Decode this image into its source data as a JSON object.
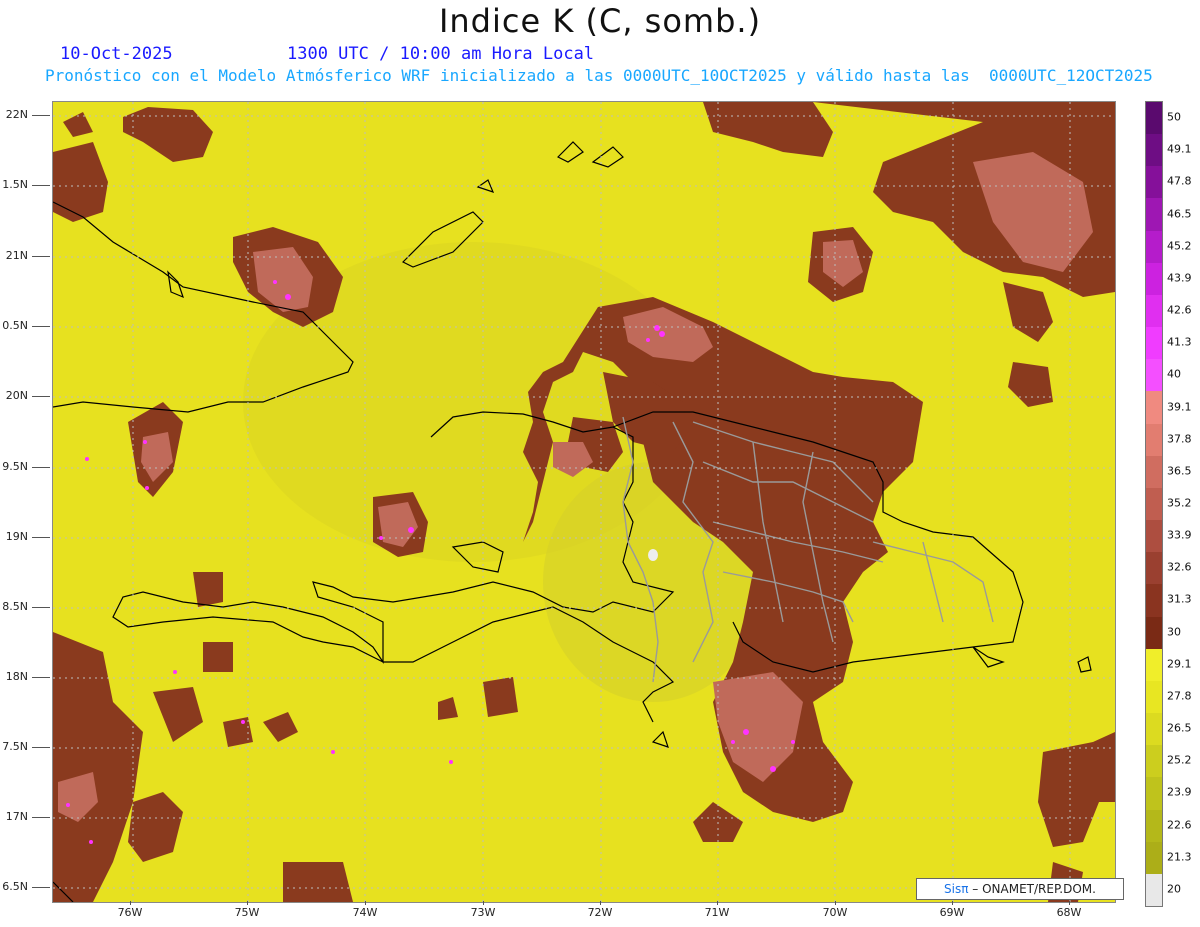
{
  "title": "Indice K (C, somb.)",
  "date": "10-Oct-2025",
  "time": "1300 UTC / 10:00 am Hora Local",
  "forecast_text": "Pronóstico con el Modelo Atmósferico WRF inicializado a las 0000UTC_10OCT2025 y válido hasta las  0000UTC_12OCT2025",
  "credit": {
    "brand": "Sisπ",
    "text": "– ONAMET/REP.DOM."
  },
  "lat_labels": [
    "22N",
    "1.5N",
    "21N",
    "0.5N",
    "20N",
    "9.5N",
    "19N",
    "8.5N",
    "18N",
    "7.5N",
    "17N",
    "6.5N"
  ],
  "lon_labels": [
    "76W",
    "75W",
    "74W",
    "73W",
    "72W",
    "71W",
    "70W",
    "69W",
    "68W"
  ],
  "colorbar": {
    "labels": [
      "50",
      "49.1",
      "47.8",
      "46.5",
      "45.2",
      "43.9",
      "42.6",
      "41.3",
      "40",
      "39.1",
      "37.8",
      "36.5",
      "35.2",
      "33.9",
      "32.6",
      "31.3",
      "30",
      "29.1",
      "27.8",
      "26.5",
      "25.2",
      "23.9",
      "22.6",
      "21.3",
      "20"
    ],
    "colors": [
      "#5a0a6e",
      "#6e0d84",
      "#85109a",
      "#9e17b3",
      "#b51ccb",
      "#cc22e0",
      "#e02ff0",
      "#f03cff",
      "#f44fff",
      "#f08a80",
      "#e27d70",
      "#d06d60",
      "#c05e50",
      "#ad4e40",
      "#9a4030",
      "#8a3420",
      "#7a2a15",
      "#f0ee2a",
      "#e8e622",
      "#dcdb20",
      "#ccce1e",
      "#bfc31c",
      "#b4b81a",
      "#acae18",
      "#e8e8e8"
    ]
  },
  "colors": {
    "base_field": "#e7e11f",
    "high_field": "#8a3a1e",
    "peak_field": "#c06a5a",
    "extreme": "#ff33ff",
    "coast": "#000000",
    "borders": "#9a9a9a"
  }
}
